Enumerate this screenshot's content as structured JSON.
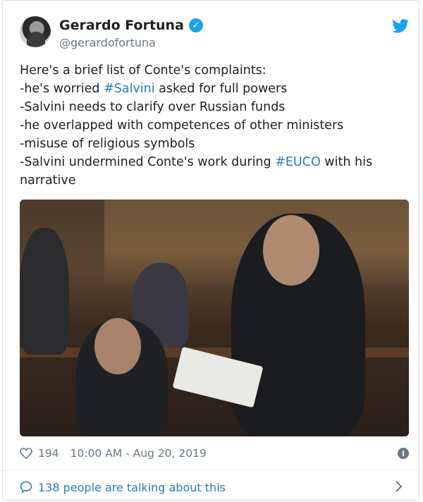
{
  "author": {
    "display_name": "Gerardo Fortuna",
    "handle": "@gerardofortuna",
    "verified_icon": "verified-badge-icon",
    "avatar_icon": "profile-photo"
  },
  "brand": {
    "icon": "twitter-bird-icon",
    "color": "#1da1f2"
  },
  "tweet": {
    "line1": "Here's a brief list of Conte's complaints:",
    "line2_prefix": "-he's worried ",
    "line2_tag": "#Salvini",
    "line2_suffix": " asked for full powers",
    "line3": "-Salvini needs to clarify over Russian funds",
    "line4": "-he overlapped with competences of other ministers",
    "line5": "-misuse of religious symbols",
    "line6_prefix": "-Salvini undermined Conte's work during ",
    "line6_tag": "#EUCO",
    "line6_suffix": " with his",
    "line7": "narrative",
    "link_color": "#2b7bb9"
  },
  "meta": {
    "like_count": "194",
    "timestamp": "10:00 AM - Aug 20, 2019",
    "info_icon": "info-icon"
  },
  "conversation": {
    "label": "138 people are talking about this"
  }
}
